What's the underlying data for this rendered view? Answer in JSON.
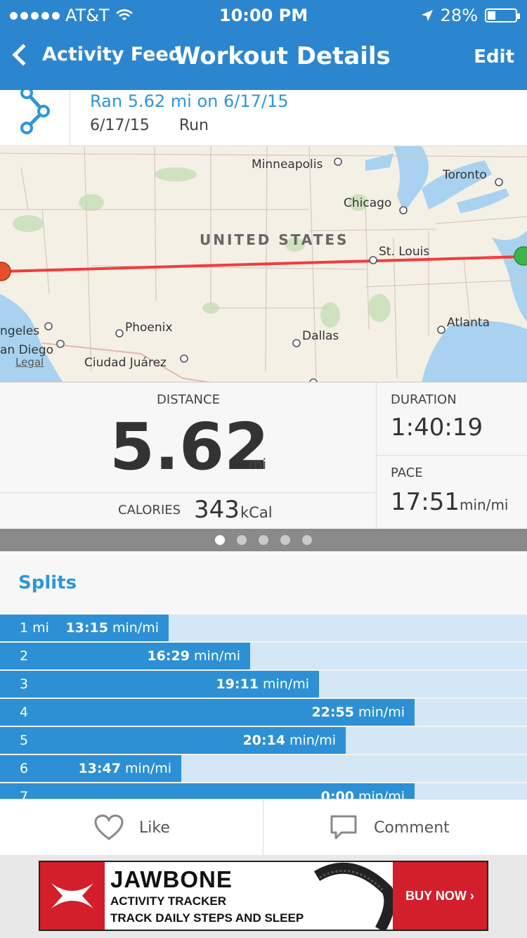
{
  "status_bar": {
    "carrier": "AT&T",
    "time": "10:00 PM",
    "battery": "28%",
    "battery_level": 0.28
  },
  "nav": {
    "back_label": "Activity Feed",
    "title": "Workout Details",
    "edit_label": "Edit"
  },
  "workout": {
    "title": "Ran 5.62 mi on 6/17/15",
    "date": "6/17/15",
    "type": "Run"
  },
  "map": {
    "country": "UNITED STATES",
    "cities": [
      "Minneapolis",
      "Toronto",
      "Chicago",
      "St. Louis",
      "ngeles",
      "an Diego",
      "Phoenix",
      "Dallas",
      "Atlanta",
      "Ciudad Juárez"
    ],
    "legal": "Legal",
    "route_color": "#f23c3c",
    "start_color": "#e5502b",
    "end_color": "#3bb54a"
  },
  "stats": {
    "distance_label": "DISTANCE",
    "distance_value": "5.62",
    "distance_unit": "mi",
    "calories_label": "CALORIES",
    "calories_value": "343",
    "calories_unit": "kCal",
    "duration_label": "DURATION",
    "duration_value": "1:40:19",
    "pace_label": "PACE",
    "pace_value": "17:51",
    "pace_unit": "min/mi"
  },
  "pager": {
    "pages": 5,
    "active": 0
  },
  "splits": {
    "heading": "Splits",
    "rows": [
      {
        "label": "1 mi",
        "pace": "13:15",
        "unit": "min/mi",
        "fraction": 0.32
      },
      {
        "label": "2",
        "pace": "16:29",
        "unit": "min/mi",
        "fraction": 0.475
      },
      {
        "label": "3",
        "pace": "19:11",
        "unit": "min/mi",
        "fraction": 0.605
      },
      {
        "label": "4",
        "pace": "22:55",
        "unit": "min/mi",
        "fraction": 0.787
      },
      {
        "label": "5",
        "pace": "20:14",
        "unit": "min/mi",
        "fraction": 0.656
      },
      {
        "label": "6",
        "pace": "13:47",
        "unit": "min/mi",
        "fraction": 0.344
      },
      {
        "label": "7",
        "pace": "0:00",
        "unit": "min/mi",
        "fraction": 0.787
      }
    ]
  },
  "actions": {
    "like_label": "Like",
    "comment_label": "Comment"
  },
  "ad": {
    "brand": "JAWBONE",
    "line1": "ACTIVITY TRACKER",
    "line2": "TRACK DAILY STEPS AND SLEEP",
    "cta": "BUY NOW ›"
  },
  "colors": {
    "accent": "#2c86cf",
    "link": "#2e97d8",
    "split_bar": "#2d90d4",
    "split_track": "#d3e7f6"
  }
}
